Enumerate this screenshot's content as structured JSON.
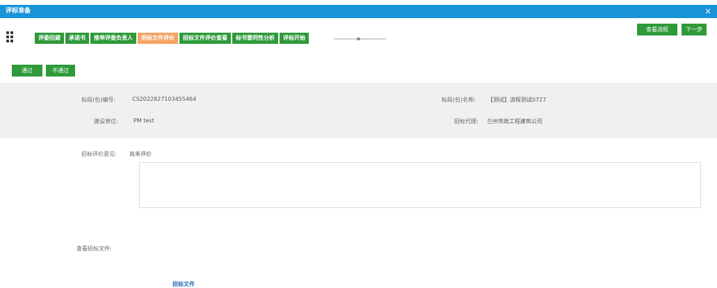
{
  "window": {
    "title": "评标准备",
    "close_icon": "×"
  },
  "steps": [
    {
      "label": "评委回避",
      "active": false
    },
    {
      "label": "承诺书",
      "active": false
    },
    {
      "label": "推举评委负责人",
      "active": false
    },
    {
      "label": "招标文件评价",
      "active": true
    },
    {
      "label": "招标文件评价查看",
      "active": false
    },
    {
      "label": "标书雷同性分析",
      "active": false
    },
    {
      "label": "评标开始",
      "active": false
    }
  ],
  "toolbar": {
    "view_flow_label": "查看流程",
    "next_label": "下一步"
  },
  "actions": {
    "pass_label": "通过",
    "fail_label": "不通过"
  },
  "info": {
    "package_no_label": "标段(包)编号:",
    "package_no_value": "CS2022827103455464",
    "package_name_label": "标段(包)名称:",
    "package_name_value": "【测试】流程测试0727",
    "builder_label": "建设单位:",
    "builder_value": "PM test",
    "agent_label": "招标代理:",
    "agent_value": "兰州市政工程建筑公司"
  },
  "evaluation": {
    "label": "招标评价意见:",
    "value": "尚未评价"
  },
  "bid_files": {
    "label": "查看招标文件:",
    "link_label": "招标文件"
  },
  "colors": {
    "titlebar": "#1793d8",
    "step_green": "#2e9a3a",
    "step_active": "#f4a261"
  }
}
